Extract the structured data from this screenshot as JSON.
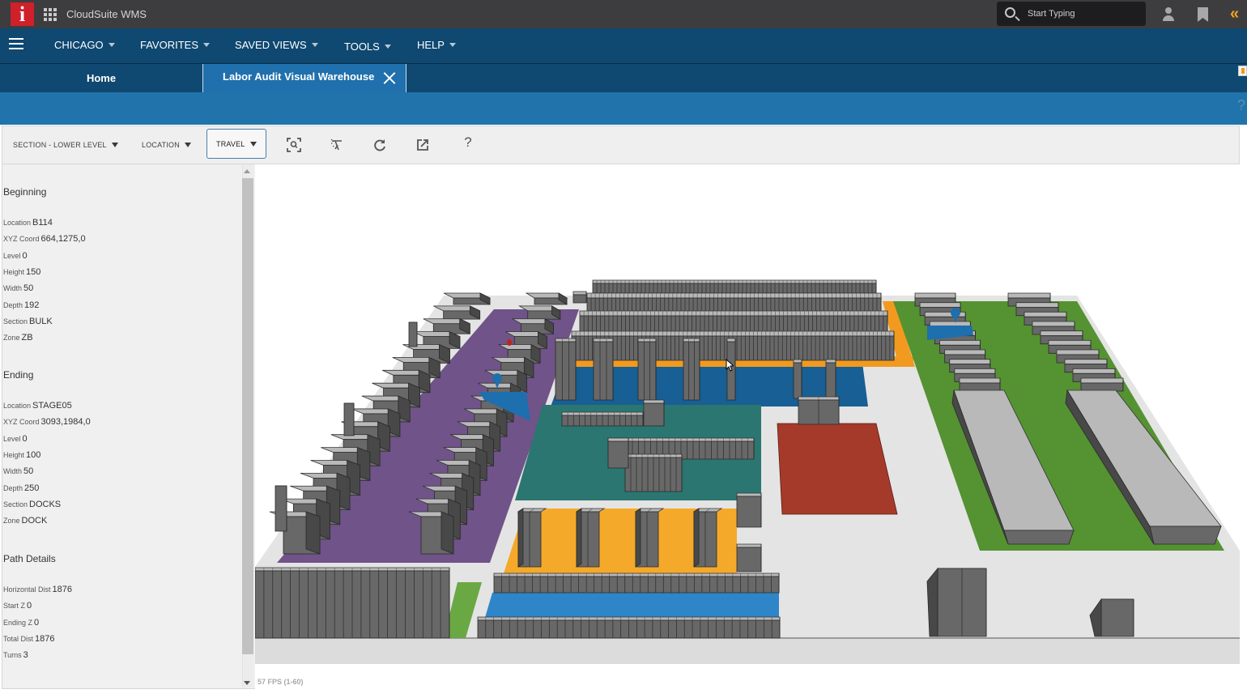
{
  "app": {
    "title": "CloudSuite WMS",
    "logo_letter": "i",
    "search_placeholder": "Start Typing",
    "icons": [
      "grid-menu-icon",
      "search-icon",
      "user-icon",
      "bookmark-icon",
      "collapse-double-chevron-icon"
    ]
  },
  "nav": {
    "items": [
      {
        "label": "CHICAGO"
      },
      {
        "label": "FAVORITES"
      },
      {
        "label": "SAVED VIEWS"
      },
      {
        "label": "TOOLS"
      },
      {
        "label": "HELP"
      }
    ]
  },
  "tabs": [
    {
      "label": "Home",
      "active": false
    },
    {
      "label": "Labor Audit Visual Warehouse",
      "active": true,
      "closable": true
    }
  ],
  "band": {
    "help_glyph": "?"
  },
  "toolbar": {
    "dropdowns": [
      {
        "label": "SECTION - LOWER LEVEL",
        "active": false
      },
      {
        "label": "LOCATION",
        "active": false
      },
      {
        "label": "TRAVEL",
        "active": true
      }
    ],
    "icon_buttons": [
      "zoom-to-fit-icon",
      "clear-path-icon",
      "refresh-icon",
      "open-external-icon",
      "help-icon"
    ],
    "help_glyph": "?"
  },
  "panel": {
    "sections": [
      {
        "title": "Beginning",
        "fields": [
          {
            "label": "Location",
            "value": "B114"
          },
          {
            "label": "XYZ Coord",
            "value": "664,1275,0"
          },
          {
            "label": "Level",
            "value": "0"
          },
          {
            "label": "Height",
            "value": "150"
          },
          {
            "label": "Width",
            "value": "50"
          },
          {
            "label": "Depth",
            "value": "192"
          },
          {
            "label": "Section",
            "value": "BULK"
          },
          {
            "label": "Zone",
            "value": "ZB"
          }
        ]
      },
      {
        "title": "Ending",
        "fields": [
          {
            "label": "Location",
            "value": "STAGE05"
          },
          {
            "label": "XYZ Coord",
            "value": "3093,1984,0"
          },
          {
            "label": "Level",
            "value": "0"
          },
          {
            "label": "Height",
            "value": "100"
          },
          {
            "label": "Width",
            "value": "50"
          },
          {
            "label": "Depth",
            "value": "250"
          },
          {
            "label": "Section",
            "value": "DOCKS"
          },
          {
            "label": "Zone",
            "value": "DOCK"
          }
        ]
      },
      {
        "title": "Path Details",
        "fields": [
          {
            "label": "Horizontal Dist",
            "value": "1876"
          },
          {
            "label": "Start Z",
            "value": "0"
          },
          {
            "label": "Ending Z",
            "value": "0"
          },
          {
            "label": "Total Dist",
            "value": "1876"
          },
          {
            "label": "Turns",
            "value": "3"
          }
        ]
      }
    ]
  },
  "viewport": {
    "fps_text": "57 FPS (1-60)",
    "zone_colors": {
      "floor": "#e4e4e4",
      "bulk_purple": "#6f5389",
      "teal": "#2b7670",
      "dock_blue": "#175f94",
      "orange": "#f29a1f",
      "yellow_orange": "#f5a92a",
      "green": "#559232",
      "staging_red": "#a63a2a",
      "bright_blue": "#2e86c8",
      "rack_top": "#b9b9b9",
      "rack_front": "#686868",
      "rack_side": "#484848",
      "marker_blue": "#1e6fae",
      "marker_red": "#c0231b"
    },
    "markers": [
      {
        "name": "path-start-marker",
        "color": "marker_blue"
      },
      {
        "name": "path-end-marker",
        "color": "marker_blue"
      },
      {
        "name": "location-marker",
        "color": "marker_red"
      }
    ]
  }
}
